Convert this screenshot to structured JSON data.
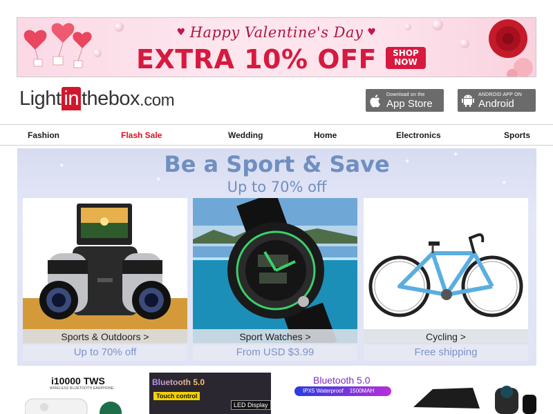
{
  "banner": {
    "greeting": "Happy Valentine's Day",
    "headline": "EXTRA 10% OFF",
    "cta_line1": "SHOP",
    "cta_line2": "NOW",
    "accent": "#d7193f"
  },
  "header": {
    "logo_part1": "Light",
    "logo_part2": "in",
    "logo_part3": "thebox",
    "logo_part4": ".com",
    "ios_small": "Download on the",
    "ios_big": "App Store",
    "android_small": "ANDROID APP ON",
    "android_big": "Android"
  },
  "nav": {
    "items": [
      "Fashion",
      "Flash Sale",
      "Wedding",
      "Home",
      "Electronics",
      "Sports"
    ],
    "sale_color": "#e0101b"
  },
  "sport": {
    "title": "Be a Sport & Save",
    "subtitle": "Up to 70% off",
    "cards": [
      {
        "label": "Sports & Outdoors >",
        "sub": "Up to 70% off",
        "icon": "binoculars-camera-icon"
      },
      {
        "label": "Sport Watches >",
        "sub": "From USD $3.99",
        "icon": "sport-watch-icon"
      },
      {
        "label": "Cycling >",
        "sub": "Free shipping",
        "icon": "road-bike-icon"
      }
    ]
  },
  "bottom": {
    "b1_title": "i10000 TWS",
    "b1_sub": "WIRELESS BLUETOOTH EARPHONE",
    "b2_title": "Bluetooth 5.0",
    "b2_touch": "Touch control",
    "b2_led": "LED Display",
    "b3_title": "Bluetooth 5.0",
    "b3_pill_a": "IPX5 Waterproof",
    "b3_pill_b": "1500MAH"
  }
}
